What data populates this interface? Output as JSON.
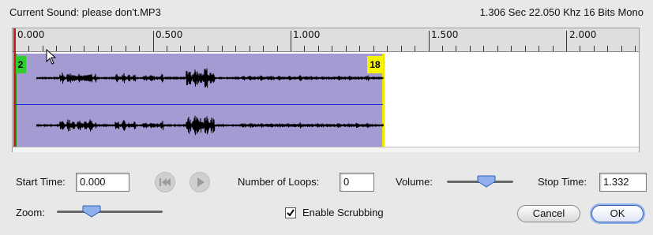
{
  "header": {
    "current_sound": "Current Sound: please don't.MP3",
    "info": "1.306 Sec 22.050 Khz 16 Bits Mono"
  },
  "ruler": {
    "labels": [
      "0.000",
      "0.500",
      "1.000",
      "1.500",
      "2.000"
    ]
  },
  "selection": {
    "start_marker": "2",
    "end_marker": "18"
  },
  "controls": {
    "start_time_label": "Start Time:",
    "start_time_value": "0.000",
    "loops_label": "Number of Loops:",
    "loops_value": "0",
    "volume_label": "Volume:",
    "volume_level": 0.6,
    "stop_time_label": "Stop Time:",
    "stop_time_value": "1.332",
    "zoom_label": "Zoom:",
    "zoom_level": 0.33,
    "scrub_label": "Enable Scrubbing",
    "scrub_checked": true,
    "cancel_label": "Cancel",
    "ok_label": "OK"
  },
  "icons": {
    "rewind": "rewind-icon",
    "play": "play-icon"
  },
  "colors": {
    "selection": "#a59bd3",
    "playhead": "#c81e1e",
    "start_marker": "#2ecc2e",
    "end_marker": "#f5f500",
    "center_line": "#1a2bd9"
  }
}
